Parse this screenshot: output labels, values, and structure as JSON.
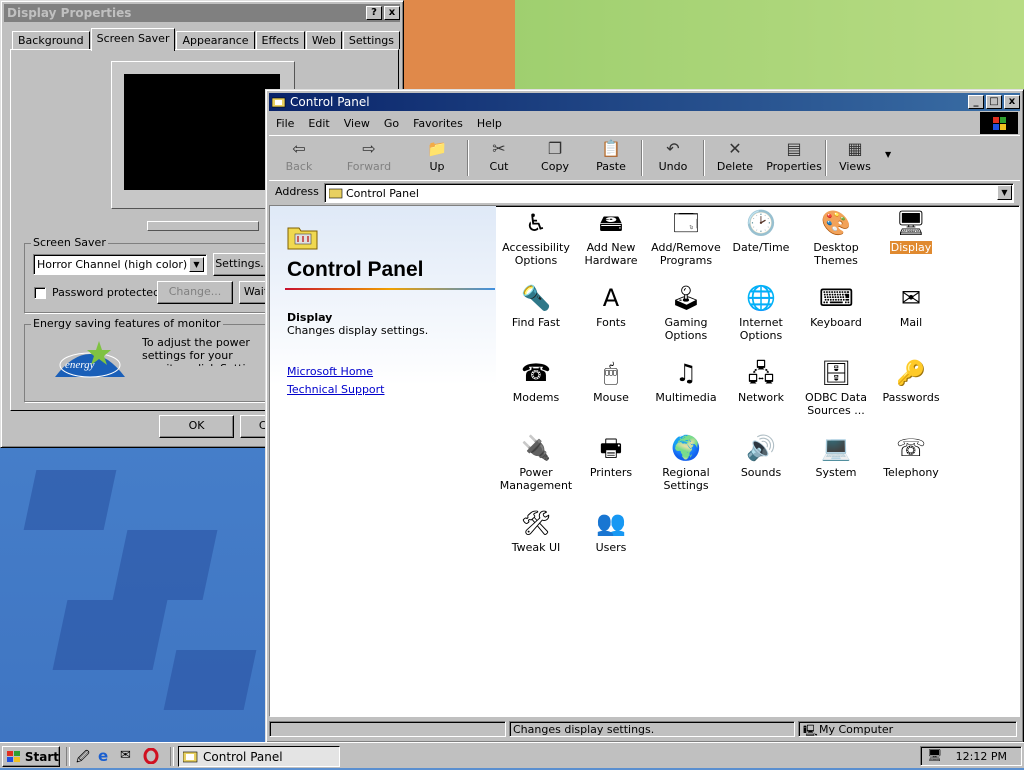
{
  "display_properties": {
    "title": "Display Properties",
    "help_btn": "?",
    "close_btn": "x",
    "tabs": [
      "Background",
      "Screen Saver",
      "Appearance",
      "Effects",
      "Web",
      "Settings"
    ],
    "selected_tab": "Screen Saver",
    "screensaver_label": "Screen Saver",
    "screensaver_value": "Horror Channel (high color)",
    "settings_btn": "Settings...",
    "password_label": "Password protected",
    "change_btn": "Change...",
    "wait_label": "Wait",
    "energy_label": "Energy saving features of monitor",
    "energy_text": "To adjust the power settings for your monitor, click Settings.",
    "ok_btn": "OK",
    "cancel_btn": "Cancel"
  },
  "control_panel": {
    "title": "Control Panel",
    "menu": [
      "File",
      "Edit",
      "View",
      "Go",
      "Favorites",
      "Help"
    ],
    "toolbar": {
      "back": "Back",
      "forward": "Forward",
      "up": "Up",
      "cut": "Cut",
      "copy": "Copy",
      "paste": "Paste",
      "undo": "Undo",
      "delete": "Delete",
      "properties": "Properties",
      "views": "Views"
    },
    "address_label": "Address",
    "address_value": "Control Panel",
    "left_title": "Control Panel",
    "selected_name": "Display",
    "selected_desc": "Changes display settings.",
    "links": [
      "Microsoft Home",
      "Technical Support"
    ],
    "icons": [
      {
        "label": "Accessibility Options",
        "icon": "accessibility-icon"
      },
      {
        "label": "Add New Hardware",
        "icon": "add-hardware-icon"
      },
      {
        "label": "Add/Remove Programs",
        "icon": "add-remove-programs-icon"
      },
      {
        "label": "Date/Time",
        "icon": "date-time-icon"
      },
      {
        "label": "Desktop Themes",
        "icon": "desktop-themes-icon"
      },
      {
        "label": "Display",
        "icon": "display-icon"
      },
      {
        "label": "Find Fast",
        "icon": "find-fast-icon"
      },
      {
        "label": "Fonts",
        "icon": "fonts-icon"
      },
      {
        "label": "Gaming Options",
        "icon": "gaming-options-icon"
      },
      {
        "label": "Internet Options",
        "icon": "internet-options-icon"
      },
      {
        "label": "Keyboard",
        "icon": "keyboard-icon"
      },
      {
        "label": "Mail",
        "icon": "mail-icon"
      },
      {
        "label": "Modems",
        "icon": "modems-icon"
      },
      {
        "label": "Mouse",
        "icon": "mouse-icon"
      },
      {
        "label": "Multimedia",
        "icon": "multimedia-icon"
      },
      {
        "label": "Network",
        "icon": "network-icon"
      },
      {
        "label": "ODBC Data Sources ...",
        "icon": "odbc-icon"
      },
      {
        "label": "Passwords",
        "icon": "passwords-icon"
      },
      {
        "label": "Power Management",
        "icon": "power-management-icon"
      },
      {
        "label": "Printers",
        "icon": "printers-icon"
      },
      {
        "label": "Regional Settings",
        "icon": "regional-settings-icon"
      },
      {
        "label": "Sounds",
        "icon": "sounds-icon"
      },
      {
        "label": "System",
        "icon": "system-icon"
      },
      {
        "label": "Telephony",
        "icon": "telephony-icon"
      },
      {
        "label": "Tweak UI",
        "icon": "tweak-ui-icon"
      },
      {
        "label": "Users",
        "icon": "users-icon"
      }
    ],
    "status_text": "Changes display settings.",
    "status_zone": "My Computer"
  },
  "taskbar": {
    "start_label": "Start",
    "task_label": "Control Panel",
    "clock": "12:12 PM"
  },
  "colors": {
    "active_title": "#0a246a",
    "inactive_title": "#808080",
    "selection": "#e08a30",
    "link": "#0000cc"
  }
}
